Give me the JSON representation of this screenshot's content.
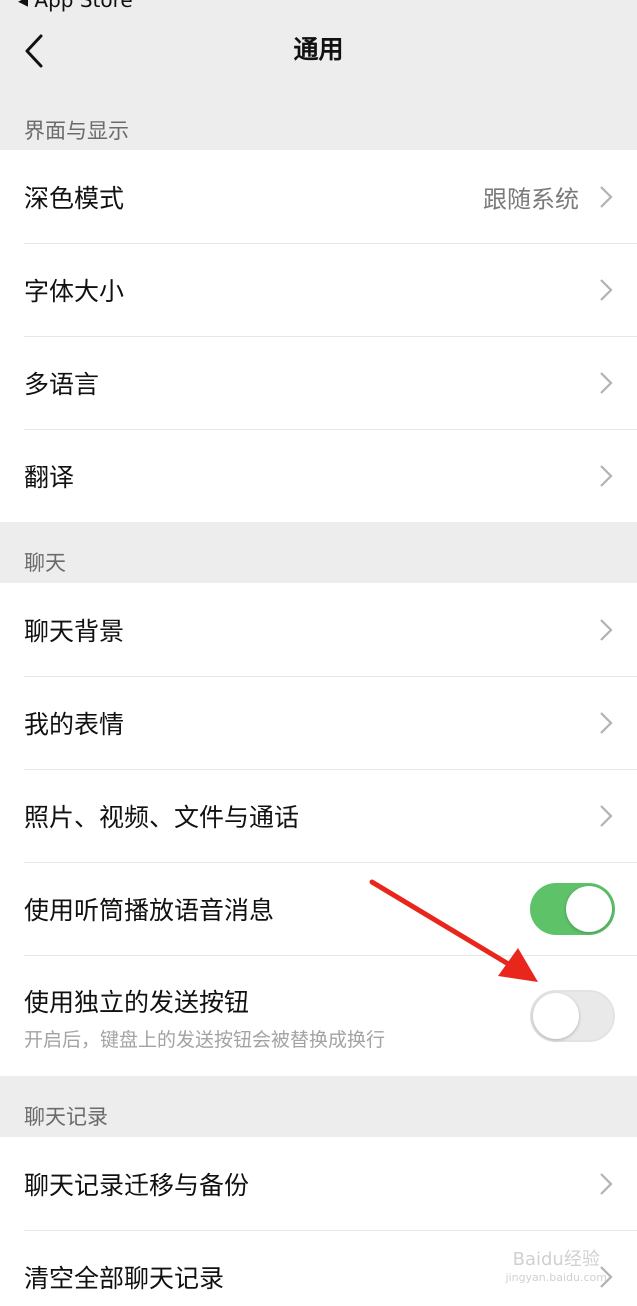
{
  "status": {
    "back_label": "◂ App Store"
  },
  "nav": {
    "title": "通用"
  },
  "sections": {
    "display": {
      "header": "界面与显示",
      "items": [
        {
          "label": "深色模式",
          "value": "跟随系统"
        },
        {
          "label": "字体大小"
        },
        {
          "label": "多语言"
        },
        {
          "label": "翻译"
        }
      ]
    },
    "chat": {
      "header": "聊天",
      "items": [
        {
          "label": "聊天背景"
        },
        {
          "label": "我的表情"
        },
        {
          "label": "照片、视频、文件与通话"
        },
        {
          "label": "使用听筒播放语音消息",
          "toggle": "on"
        },
        {
          "label": "使用独立的发送按钮",
          "sub": "开启后，键盘上的发送按钮会被替换成换行",
          "toggle": "off"
        }
      ]
    },
    "history": {
      "header": "聊天记录",
      "items": [
        {
          "label": "聊天记录迁移与备份"
        },
        {
          "label": "清空全部聊天记录"
        }
      ]
    }
  },
  "colors": {
    "toggle_on": "#5ec269",
    "annotation_arrow": "#e8261c"
  },
  "watermark": {
    "brand": "Baidu经验",
    "url": "jingyan.baidu.com"
  }
}
